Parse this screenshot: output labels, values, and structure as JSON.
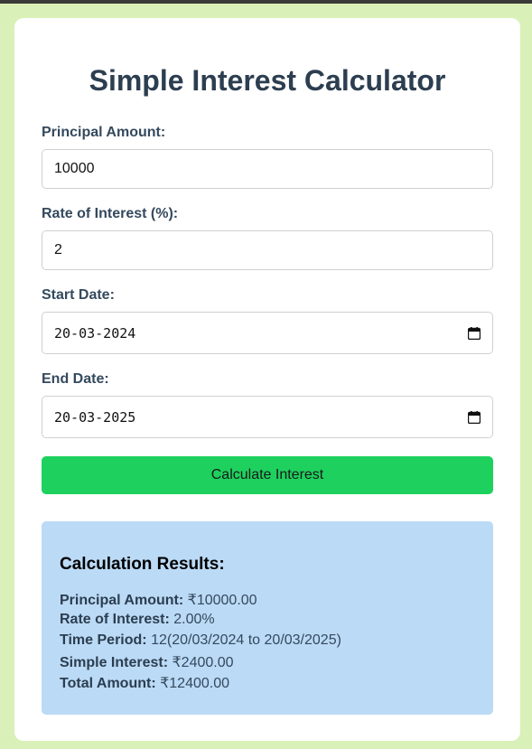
{
  "title": "Simple Interest Calculator",
  "form": {
    "principal": {
      "label": "Principal Amount:",
      "value": "10000"
    },
    "rate": {
      "label": "Rate of Interest (%):",
      "value": "2"
    },
    "start_date": {
      "label": "Start Date:",
      "value": "20-03-2024"
    },
    "end_date": {
      "label": "End Date:",
      "value": "20-03-2025"
    },
    "calculate_label": "Calculate Interest"
  },
  "results": {
    "title": "Calculation Results:",
    "lines": [
      {
        "key": "Principal Amount:",
        "value": "₹10000.00"
      },
      {
        "key": "Rate of Interest:",
        "value": "2.00%"
      },
      {
        "key": "Time Period:",
        "value": "12(20/03/2024 to 20/03/2025)"
      },
      {
        "key": "Simple Interest:",
        "value": "₹2400.00"
      },
      {
        "key": "Total Amount:",
        "value": "₹12400.00"
      }
    ]
  },
  "colors": {
    "page_bg": "#d9f0b8",
    "button": "#1ed15e",
    "results_bg": "#bbdaf6",
    "title": "#2c3e50"
  }
}
